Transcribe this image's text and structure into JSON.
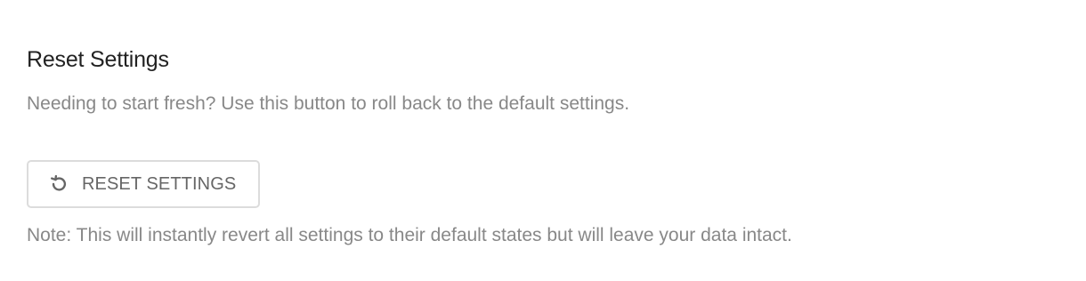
{
  "reset_section": {
    "title": "Reset Settings",
    "description": "Needing to start fresh? Use this button to roll back to the default settings.",
    "button": {
      "icon": "undo-icon",
      "label": "RESET SETTINGS"
    },
    "note": "Note: This will instantly revert all settings to their default states but will leave your data intact."
  },
  "colors": {
    "title": "#222222",
    "muted_text": "#888888",
    "button_text": "#666666",
    "button_border": "#dcdcdc"
  }
}
